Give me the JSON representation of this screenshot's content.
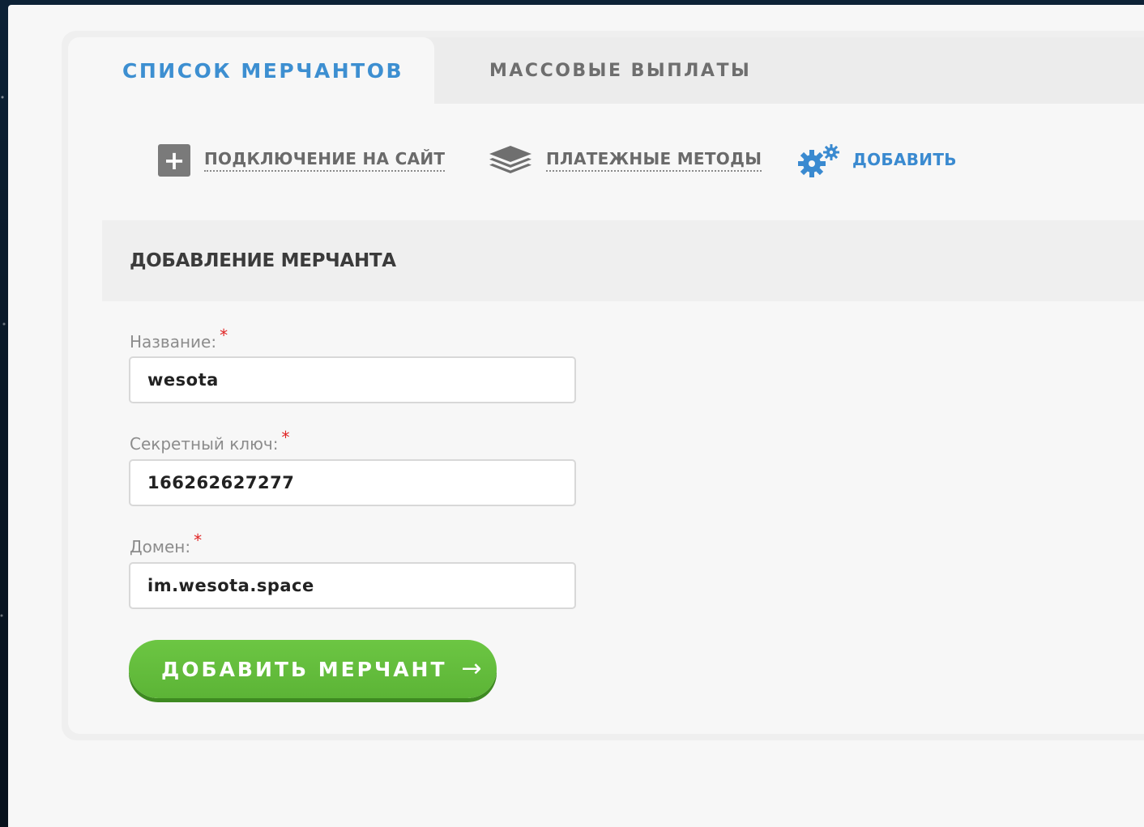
{
  "tabs": [
    {
      "label": "СПИСОК МЕРЧАНТОВ",
      "active": true
    },
    {
      "label": "МАССОВЫЕ ВЫПЛАТЫ",
      "active": false
    }
  ],
  "toolbar": {
    "connect": {
      "label": "ПОДКЛЮЧЕНИЕ НА САЙТ",
      "icon": "plus-box-icon"
    },
    "methods": {
      "label": "ПЛАТЕЖНЫЕ МЕТОДЫ",
      "icon": "layers-icon"
    },
    "add": {
      "label": "ДОБАВИТЬ",
      "icon": "gears-icon"
    }
  },
  "section": {
    "title": "ДОБАВЛЕНИЕ МЕРЧАНТА"
  },
  "form": {
    "required_mark": "*",
    "name": {
      "label": "Название:",
      "value": "wesota"
    },
    "secret_key": {
      "label": "Секретный ключ:",
      "value": "166262627277"
    },
    "domain": {
      "label": "Домен:",
      "value": "im.wesota.space"
    },
    "submit_label": "ДОБАВИТЬ МЕРЧАНТ",
    "submit_icon": "arrow-right-icon"
  },
  "colors": {
    "accent_blue": "#3d8fd1",
    "submit_green": "#62bd3c",
    "required_red": "#e02424"
  }
}
